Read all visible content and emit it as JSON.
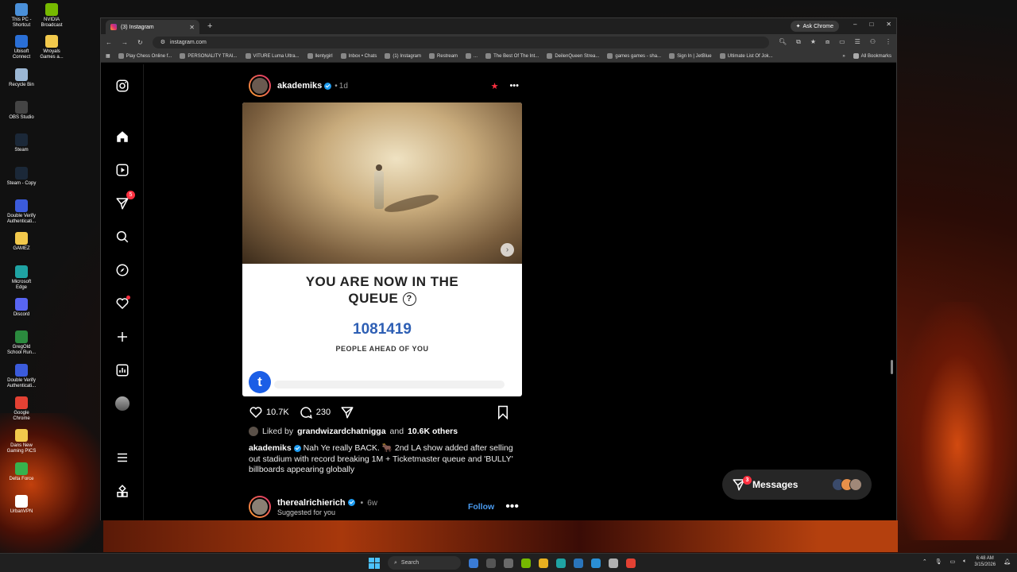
{
  "desktop": {
    "icons": [
      {
        "label": "This PC - Shortcut",
        "color": "#4a90d9"
      },
      {
        "label": "NVIDIA Broadcast",
        "color": "#76b900"
      },
      {
        "label": "Ubisoft Connect",
        "color": "#2a6fd6"
      },
      {
        "label": "Wroyals Games a...",
        "color": "#f2c94c"
      },
      {
        "label": "Recycle Bin",
        "color": "#9bb7d4"
      },
      {
        "label": "OBS Studio",
        "color": "#444444"
      },
      {
        "label": "Steam",
        "color": "#1b2838"
      },
      {
        "label": "Steam - Copy",
        "color": "#1b2838"
      },
      {
        "label": "Double Verify Authenticati...",
        "color": "#3b5bdb"
      },
      {
        "label": "GAMEZ",
        "color": "#f2c94c"
      },
      {
        "label": "Microsoft Edge",
        "color": "#1fa3a3"
      },
      {
        "label": "Discord",
        "color": "#5865f2"
      },
      {
        "label": "GregOld School Run...",
        "color": "#2b8a3e"
      },
      {
        "label": "Double Verify Authenticati...",
        "color": "#3b5bdb"
      },
      {
        "label": "Google Chrome",
        "color": "#e34133"
      },
      {
        "label": "Dans New Gaming PICS",
        "color": "#f2c94c"
      },
      {
        "label": "Delta Force",
        "color": "#37b24d"
      },
      {
        "label": "UrbanVPN",
        "color": "#ffffff"
      }
    ]
  },
  "browser": {
    "tab_title": "(3) Instagram",
    "new_tab": "+",
    "ask_chrome": "Ask Chrome",
    "window_controls": [
      "–",
      "□",
      "✕"
    ],
    "url": "instagram.com",
    "bookmarks": [
      "Play Chess Online f...",
      "PERSONALITY TRAI...",
      "VITURE Luma Ultra...",
      "llentygirl",
      "Inbox • Chats",
      "(1) Instagram",
      "Restream",
      "...",
      "The Best Of The Int...",
      "DeilenQueen Strea...",
      "games games - sha...",
      "Sign In | JetBlue",
      "Ultimate List Of Jok..."
    ],
    "bookmarks_more": "»",
    "all_bookmarks": "All Bookmarks"
  },
  "nav": {
    "messages_badge": "5"
  },
  "post": {
    "username": "akademiks",
    "dot": "•",
    "time": "1d",
    "queue_title_line1": "YOU ARE NOW IN THE",
    "queue_title_line2": "QUEUE",
    "queue_help": "?",
    "queue_number": "1081419",
    "queue_sub": "PEOPLE AHEAD OF YOU",
    "tm_logo": "t",
    "likes_count": "10.7K",
    "comments_count": "230",
    "liked_by_prefix": "Liked by",
    "liked_by_user": "grandwizardchatnigga",
    "liked_by_and": "and",
    "liked_by_others": "10.6K others",
    "caption_user": "akademiks",
    "caption_text": "Nah Ye really BACK. 🐂 2nd LA show added after selling out stadium with record breaking 1M + Ticketmaster queue and 'BULLY' billboards appearing globally"
  },
  "next_post": {
    "username": "therealrichierich",
    "dot": "•",
    "time": "6w",
    "sub": "Suggested for you",
    "follow": "Follow"
  },
  "messages": {
    "label": "Messages",
    "badge": "3"
  },
  "taskbar": {
    "search": "Search",
    "time": "6:48 AM",
    "date": "3/15/2026"
  }
}
